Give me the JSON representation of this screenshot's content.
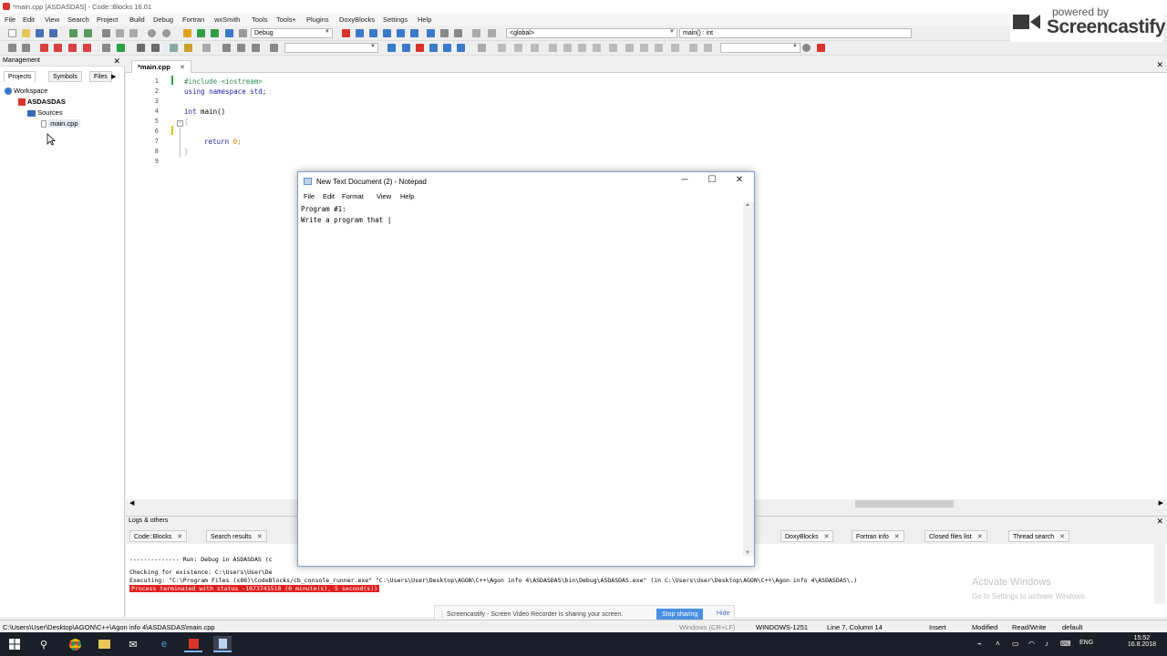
{
  "window": {
    "title": "*main.cpp [ASDASDAS] - Code::Blocks 16.01"
  },
  "menu": [
    "File",
    "Edit",
    "View",
    "Search",
    "Project",
    "Build",
    "Debug",
    "Fortran",
    "wxSmith",
    "Tools",
    "Tools+",
    "Plugins",
    "DoxyBlocks",
    "Settings",
    "Help"
  ],
  "toolbar": {
    "build_target": "Debug",
    "scope": "<global>",
    "function": "main() : int"
  },
  "logo": {
    "powered": "powered by",
    "name": "Screencastify"
  },
  "management": {
    "title": "Management",
    "tabs": [
      "Projects",
      "Symbols",
      "Files"
    ],
    "tree": {
      "workspace": "Workspace",
      "project": "ASDASDAS",
      "folder": "Sources",
      "file": "main.cpp"
    }
  },
  "editor": {
    "tab": "*main.cpp",
    "line_numbers": [
      "1",
      "2",
      "3",
      "4",
      "5",
      "6",
      "7",
      "8",
      "9"
    ],
    "code": {
      "l1": "#include <iostream>",
      "l2": "using namespace std;",
      "l4a": "int",
      "l4b": " main()",
      "l5": "{",
      "l7a": "return",
      "l7b": " 0;",
      "l8": "}"
    }
  },
  "notepad": {
    "title": "New Text Document (2) - Notepad",
    "menu": [
      "File",
      "Edit",
      "Format",
      "View",
      "Help"
    ],
    "text": "Program #1:\nWrite a program that |"
  },
  "logs": {
    "title": "Logs & others",
    "tabs": [
      "Code::Blocks",
      "Search results",
      "DoxyBlocks",
      "Fortran info",
      "Closed files list",
      "Thread search"
    ],
    "lines": [
      "-------------- Run: Debug in ASDASDAS (c",
      "Checking for existence: C:\\Users\\User\\De",
      "Executing: \"C:\\Program Files (x86)\\CodeBlocks/cb_console_runner.exe\" \"C:\\Users\\User\\Desktop\\AGON\\C++\\Agon info 4\\ASDASDAS\\bin\\Debug\\ASDASDAS.exe\"  (in C:\\Users\\User\\Desktop\\AGON\\C++\\Agon info 4\\ASDASDAS\\.)",
      "Process terminated with status -1073741510 (0 minute(s), 5 second(s))"
    ],
    "watermark_title": "Activate Windows",
    "watermark_sub": "Go to Settings to activate Windows."
  },
  "sharebar": {
    "message": "Screencastify - Screen Video Recorder is sharing your screen.",
    "stop": "Stop sharing",
    "hide": "Hide"
  },
  "status": {
    "path": "C:\\Users\\User\\Desktop\\AGON\\C++\\Agon info 4\\ASDASDAS\\main.cpp",
    "encoding": "WINDOWS-1251",
    "position": "Line 7, Column 14",
    "mode": "Insert",
    "modified": "Modified",
    "access": "Read/Write",
    "profile": "default",
    "enc_prefix": "Windows (CR+LF)"
  },
  "taskbar": {
    "lang": "ENG",
    "time": "15:52",
    "date": "16.8.2018"
  },
  "colors": {
    "accent": "#4a90e2",
    "error": "#e0201e",
    "taskbar": "#1b1f27"
  }
}
